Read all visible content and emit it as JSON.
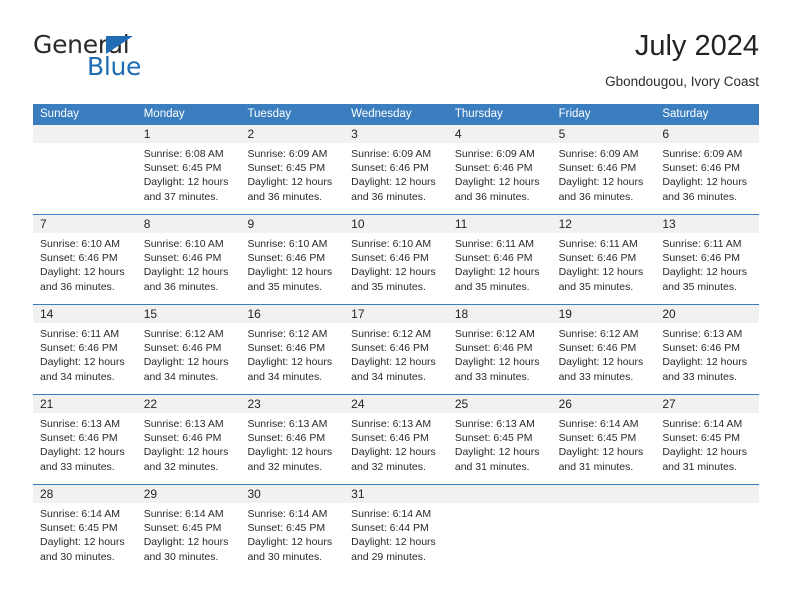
{
  "brand": {
    "name_part1": "General",
    "name_part2": "Blue",
    "triangle_icon": "triangle-icon",
    "accent_color": "#1f6cb5"
  },
  "header": {
    "title": "July 2024",
    "subtitle": "Gbondougou, Ivory Coast"
  },
  "calendar": {
    "header_bg": "#3a7ebf",
    "daynum_bg": "#f1f1f1",
    "weekdays": [
      "Sunday",
      "Monday",
      "Tuesday",
      "Wednesday",
      "Thursday",
      "Friday",
      "Saturday"
    ],
    "weeks": [
      [
        {
          "day": "",
          "sunrise": "",
          "sunset": "",
          "daylight_1": "",
          "daylight_2": ""
        },
        {
          "day": "1",
          "sunrise": "Sunrise: 6:08 AM",
          "sunset": "Sunset: 6:45 PM",
          "daylight_1": "Daylight: 12 hours",
          "daylight_2": "and 37 minutes."
        },
        {
          "day": "2",
          "sunrise": "Sunrise: 6:09 AM",
          "sunset": "Sunset: 6:45 PM",
          "daylight_1": "Daylight: 12 hours",
          "daylight_2": "and 36 minutes."
        },
        {
          "day": "3",
          "sunrise": "Sunrise: 6:09 AM",
          "sunset": "Sunset: 6:46 PM",
          "daylight_1": "Daylight: 12 hours",
          "daylight_2": "and 36 minutes."
        },
        {
          "day": "4",
          "sunrise": "Sunrise: 6:09 AM",
          "sunset": "Sunset: 6:46 PM",
          "daylight_1": "Daylight: 12 hours",
          "daylight_2": "and 36 minutes."
        },
        {
          "day": "5",
          "sunrise": "Sunrise: 6:09 AM",
          "sunset": "Sunset: 6:46 PM",
          "daylight_1": "Daylight: 12 hours",
          "daylight_2": "and 36 minutes."
        },
        {
          "day": "6",
          "sunrise": "Sunrise: 6:09 AM",
          "sunset": "Sunset: 6:46 PM",
          "daylight_1": "Daylight: 12 hours",
          "daylight_2": "and 36 minutes."
        }
      ],
      [
        {
          "day": "7",
          "sunrise": "Sunrise: 6:10 AM",
          "sunset": "Sunset: 6:46 PM",
          "daylight_1": "Daylight: 12 hours",
          "daylight_2": "and 36 minutes."
        },
        {
          "day": "8",
          "sunrise": "Sunrise: 6:10 AM",
          "sunset": "Sunset: 6:46 PM",
          "daylight_1": "Daylight: 12 hours",
          "daylight_2": "and 36 minutes."
        },
        {
          "day": "9",
          "sunrise": "Sunrise: 6:10 AM",
          "sunset": "Sunset: 6:46 PM",
          "daylight_1": "Daylight: 12 hours",
          "daylight_2": "and 35 minutes."
        },
        {
          "day": "10",
          "sunrise": "Sunrise: 6:10 AM",
          "sunset": "Sunset: 6:46 PM",
          "daylight_1": "Daylight: 12 hours",
          "daylight_2": "and 35 minutes."
        },
        {
          "day": "11",
          "sunrise": "Sunrise: 6:11 AM",
          "sunset": "Sunset: 6:46 PM",
          "daylight_1": "Daylight: 12 hours",
          "daylight_2": "and 35 minutes."
        },
        {
          "day": "12",
          "sunrise": "Sunrise: 6:11 AM",
          "sunset": "Sunset: 6:46 PM",
          "daylight_1": "Daylight: 12 hours",
          "daylight_2": "and 35 minutes."
        },
        {
          "day": "13",
          "sunrise": "Sunrise: 6:11 AM",
          "sunset": "Sunset: 6:46 PM",
          "daylight_1": "Daylight: 12 hours",
          "daylight_2": "and 35 minutes."
        }
      ],
      [
        {
          "day": "14",
          "sunrise": "Sunrise: 6:11 AM",
          "sunset": "Sunset: 6:46 PM",
          "daylight_1": "Daylight: 12 hours",
          "daylight_2": "and 34 minutes."
        },
        {
          "day": "15",
          "sunrise": "Sunrise: 6:12 AM",
          "sunset": "Sunset: 6:46 PM",
          "daylight_1": "Daylight: 12 hours",
          "daylight_2": "and 34 minutes."
        },
        {
          "day": "16",
          "sunrise": "Sunrise: 6:12 AM",
          "sunset": "Sunset: 6:46 PM",
          "daylight_1": "Daylight: 12 hours",
          "daylight_2": "and 34 minutes."
        },
        {
          "day": "17",
          "sunrise": "Sunrise: 6:12 AM",
          "sunset": "Sunset: 6:46 PM",
          "daylight_1": "Daylight: 12 hours",
          "daylight_2": "and 34 minutes."
        },
        {
          "day": "18",
          "sunrise": "Sunrise: 6:12 AM",
          "sunset": "Sunset: 6:46 PM",
          "daylight_1": "Daylight: 12 hours",
          "daylight_2": "and 33 minutes."
        },
        {
          "day": "19",
          "sunrise": "Sunrise: 6:12 AM",
          "sunset": "Sunset: 6:46 PM",
          "daylight_1": "Daylight: 12 hours",
          "daylight_2": "and 33 minutes."
        },
        {
          "day": "20",
          "sunrise": "Sunrise: 6:13 AM",
          "sunset": "Sunset: 6:46 PM",
          "daylight_1": "Daylight: 12 hours",
          "daylight_2": "and 33 minutes."
        }
      ],
      [
        {
          "day": "21",
          "sunrise": "Sunrise: 6:13 AM",
          "sunset": "Sunset: 6:46 PM",
          "daylight_1": "Daylight: 12 hours",
          "daylight_2": "and 33 minutes."
        },
        {
          "day": "22",
          "sunrise": "Sunrise: 6:13 AM",
          "sunset": "Sunset: 6:46 PM",
          "daylight_1": "Daylight: 12 hours",
          "daylight_2": "and 32 minutes."
        },
        {
          "day": "23",
          "sunrise": "Sunrise: 6:13 AM",
          "sunset": "Sunset: 6:46 PM",
          "daylight_1": "Daylight: 12 hours",
          "daylight_2": "and 32 minutes."
        },
        {
          "day": "24",
          "sunrise": "Sunrise: 6:13 AM",
          "sunset": "Sunset: 6:46 PM",
          "daylight_1": "Daylight: 12 hours",
          "daylight_2": "and 32 minutes."
        },
        {
          "day": "25",
          "sunrise": "Sunrise: 6:13 AM",
          "sunset": "Sunset: 6:45 PM",
          "daylight_1": "Daylight: 12 hours",
          "daylight_2": "and 31 minutes."
        },
        {
          "day": "26",
          "sunrise": "Sunrise: 6:14 AM",
          "sunset": "Sunset: 6:45 PM",
          "daylight_1": "Daylight: 12 hours",
          "daylight_2": "and 31 minutes."
        },
        {
          "day": "27",
          "sunrise": "Sunrise: 6:14 AM",
          "sunset": "Sunset: 6:45 PM",
          "daylight_1": "Daylight: 12 hours",
          "daylight_2": "and 31 minutes."
        }
      ],
      [
        {
          "day": "28",
          "sunrise": "Sunrise: 6:14 AM",
          "sunset": "Sunset: 6:45 PM",
          "daylight_1": "Daylight: 12 hours",
          "daylight_2": "and 30 minutes."
        },
        {
          "day": "29",
          "sunrise": "Sunrise: 6:14 AM",
          "sunset": "Sunset: 6:45 PM",
          "daylight_1": "Daylight: 12 hours",
          "daylight_2": "and 30 minutes."
        },
        {
          "day": "30",
          "sunrise": "Sunrise: 6:14 AM",
          "sunset": "Sunset: 6:45 PM",
          "daylight_1": "Daylight: 12 hours",
          "daylight_2": "and 30 minutes."
        },
        {
          "day": "31",
          "sunrise": "Sunrise: 6:14 AM",
          "sunset": "Sunset: 6:44 PM",
          "daylight_1": "Daylight: 12 hours",
          "daylight_2": "and 29 minutes."
        },
        {
          "day": "",
          "sunrise": "",
          "sunset": "",
          "daylight_1": "",
          "daylight_2": ""
        },
        {
          "day": "",
          "sunrise": "",
          "sunset": "",
          "daylight_1": "",
          "daylight_2": ""
        },
        {
          "day": "",
          "sunrise": "",
          "sunset": "",
          "daylight_1": "",
          "daylight_2": ""
        }
      ]
    ]
  }
}
